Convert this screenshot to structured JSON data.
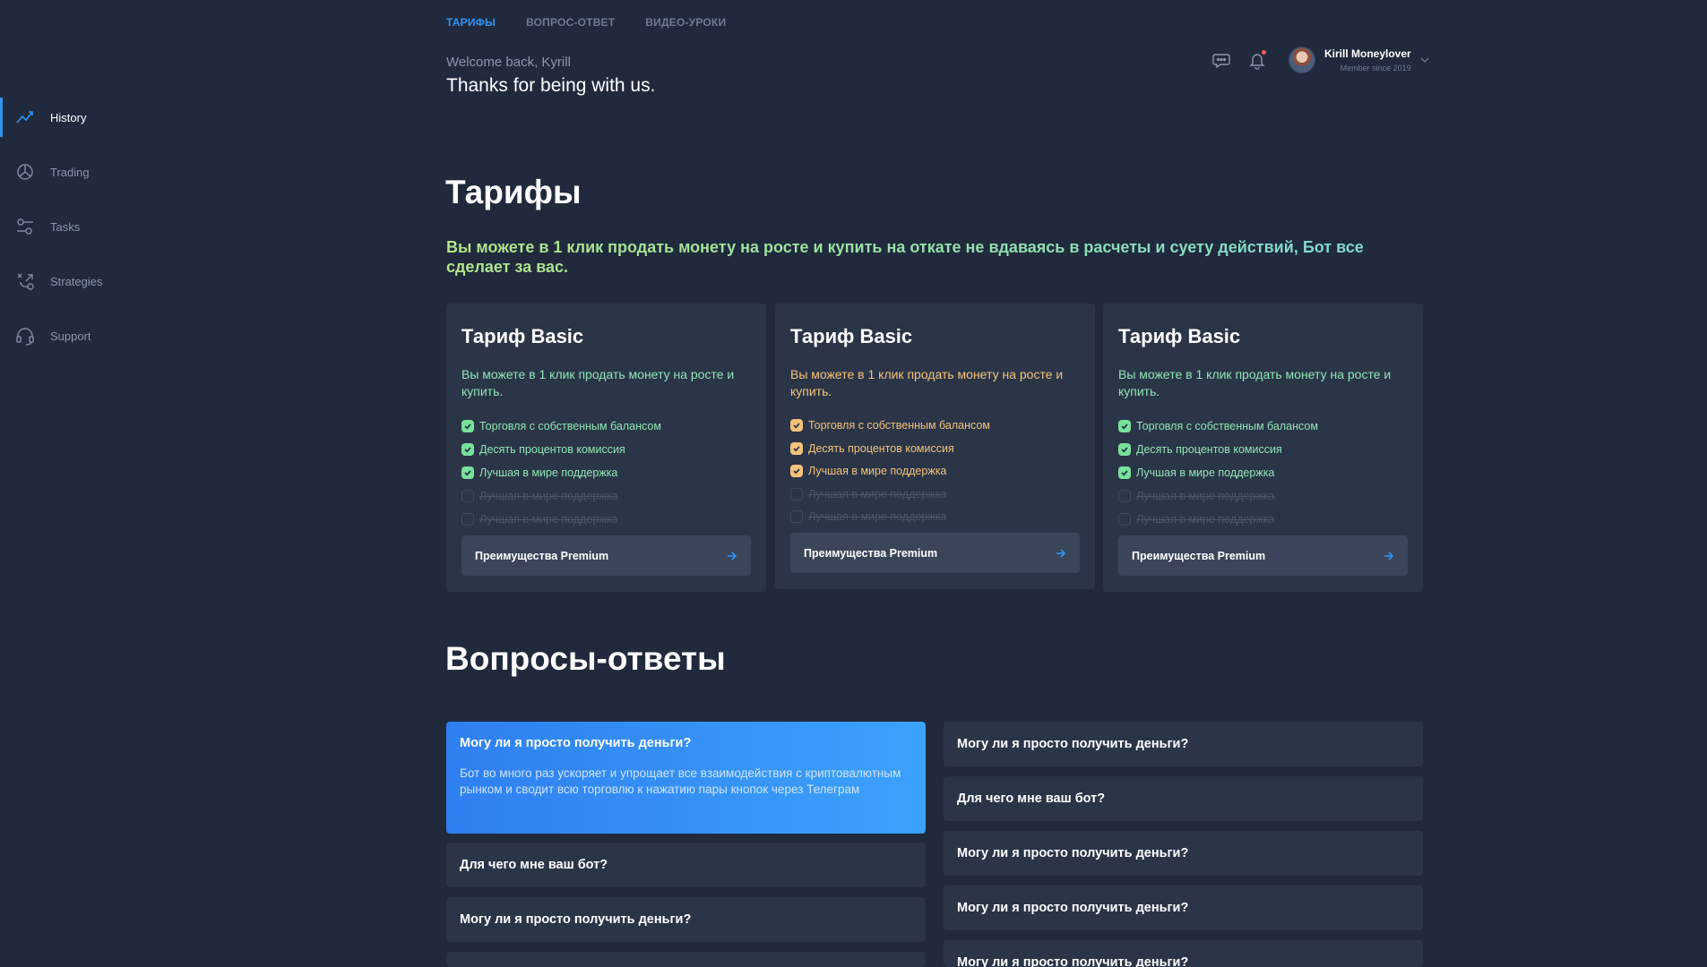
{
  "topnav": {
    "tabs": [
      {
        "label": "ТАРИФЫ",
        "active": true
      },
      {
        "label": "ВОПРОС-ОТВЕТ",
        "active": false
      },
      {
        "label": "ВИДЕО-УРОКИ",
        "active": false
      }
    ]
  },
  "header": {
    "welcome": "Welcome back, Kyrill",
    "thanks": "Thanks for being with us.",
    "user_name": "Kirill Moneylover",
    "user_since": "Member since 2019",
    "icons": [
      "chat-icon",
      "bell-icon",
      "chevron-down-icon"
    ]
  },
  "sidebar": {
    "items": [
      {
        "label": "History",
        "icon": "chart-line-icon",
        "active": true
      },
      {
        "label": "Trading",
        "icon": "pie-chart-icon",
        "active": false
      },
      {
        "label": "Tasks",
        "icon": "sliders-icon",
        "active": false
      },
      {
        "label": "Strategies",
        "icon": "strategy-icon",
        "active": false
      },
      {
        "label": "Support",
        "icon": "headset-icon",
        "active": false
      }
    ]
  },
  "tariffs": {
    "title": "Тарифы",
    "lead": "Вы можете в 1 клик продать монету на росте и купить на откате не вдаваясь в расчеты и суету действий, Бот все сделает за вас.",
    "cards": [
      {
        "title": "Тариф Basic",
        "desc": "Вы можете в 1 клик продать монету на росте и купить.",
        "accent": "#8fe6b2",
        "features": [
          {
            "text": "Торговля с собственным балансом",
            "enabled": true
          },
          {
            "text": "Десять процентов комиссия",
            "enabled": true
          },
          {
            "text": "Лучшая в мире поддержка",
            "enabled": true
          },
          {
            "text": "Лучшая в мире поддержка",
            "enabled": false
          },
          {
            "text": "Лучшая в мире поддержка",
            "enabled": false
          }
        ],
        "button": "Преимущества Premium"
      },
      {
        "title": "Тариф Basic",
        "desc": "Вы можете в 1 клик продать монету на росте и купить.",
        "accent": "#f5c27a",
        "features": [
          {
            "text": "Торговля с собственным балансом",
            "enabled": true
          },
          {
            "text": "Десять процентов комиссия",
            "enabled": true
          },
          {
            "text": "Лучшая в мире поддержка",
            "enabled": true
          },
          {
            "text": "Лучшая в мире поддержка",
            "enabled": false
          },
          {
            "text": "Лучшая в мире поддержка",
            "enabled": false
          }
        ],
        "button": "Преимущества Premium"
      },
      {
        "title": "Тариф Basic",
        "desc": "Вы можете в 1 клик продать монету на росте и купить.",
        "accent": "#8fe6b2",
        "features": [
          {
            "text": "Торговля с собственным балансом",
            "enabled": true
          },
          {
            "text": "Десять процентов комиссия",
            "enabled": true
          },
          {
            "text": "Лучшая в мире поддержка",
            "enabled": true
          },
          {
            "text": "Лучшая в мире поддержка",
            "enabled": false
          },
          {
            "text": "Лучшая в мире поддержка",
            "enabled": false
          }
        ],
        "button": "Преимущества Premium"
      }
    ]
  },
  "faq": {
    "title": "Вопросы-ответы",
    "open_item": {
      "question": "Могу ли я просто получить деньги?",
      "answer": "Бот во много раз ускоряет и упрощает все взаимодействия с криптовалютным рынком и сводит всю торговлю к нажатию пары кнопок через Телеграм"
    },
    "left_items": [
      "Для чего мне ваш бот?",
      "Могу ли я просто получить деньги?"
    ],
    "right_items": [
      "Могу ли я просто получить деньги?",
      "Для чего мне ваш бот?",
      "Могу ли я просто получить деньги?",
      "Могу ли я просто получить деньги?",
      "Могу ли я просто получить деньги?"
    ]
  },
  "colors": {
    "background": "#202a3c",
    "card": "#2b3548",
    "accent_blue": "#2f95f7",
    "green": "#8fe6b2",
    "orange": "#f5c27a"
  }
}
